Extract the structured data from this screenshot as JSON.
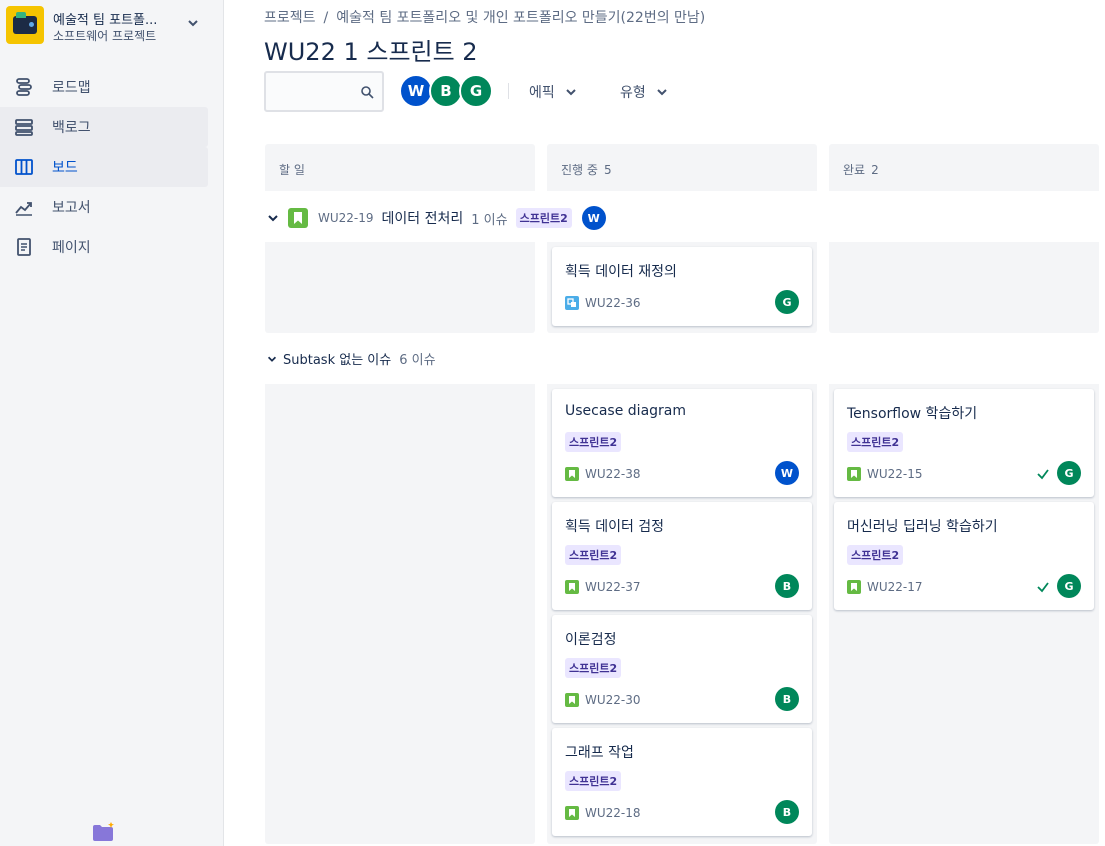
{
  "colors": {
    "accent": "#0052cc",
    "avatar_w": "#0052cc",
    "avatar_g": "#00875a",
    "avatar_b": "#00875a",
    "story": "#65ba43",
    "subtask": "#4bade8",
    "label_bg": "#eae6ff",
    "done_check": "#00875a"
  },
  "project": {
    "name": "예술적 팀 포트폴...",
    "type": "소프트웨어 프로젝트",
    "logo_icon": "project-logo-icon"
  },
  "sidebar": {
    "items": [
      {
        "label": "로드맵",
        "icon": "roadmap-icon"
      },
      {
        "label": "백로그",
        "icon": "backlog-icon"
      },
      {
        "label": "보드",
        "icon": "board-icon"
      },
      {
        "label": "보고서",
        "icon": "reports-icon"
      },
      {
        "label": "페이지",
        "icon": "pages-icon"
      }
    ]
  },
  "breadcrumb": {
    "root": "프로젝트",
    "separator": "/",
    "current": "예술적 팀 포트폴리오 및 개인 포트폴리오 만들기(22번의 만남)"
  },
  "page": {
    "title": "WU22 1 스프린트 2"
  },
  "toolbar": {
    "search_placeholder": "",
    "avatars": [
      "W",
      "B",
      "G"
    ],
    "filters": [
      "에픽",
      "유형"
    ]
  },
  "columns": [
    {
      "name": "할 일",
      "count": ""
    },
    {
      "name": "진행 중",
      "count": "5"
    },
    {
      "name": "완료",
      "count": "2"
    }
  ],
  "swimlanes": {
    "epic": {
      "key": "WU22-19",
      "title": "데이터 전처리",
      "count": "1 이슈",
      "label": "스프린트2",
      "assignee": "W"
    },
    "no_subtask": {
      "title": "Subtask 없는 이슈",
      "count": "6 이슈"
    }
  },
  "cards": {
    "c36": {
      "title": "획득 데이터 재정의",
      "key": "WU22-36",
      "assignee": "G"
    },
    "c38": {
      "title": "Usecase diagram",
      "label": "스프린트2",
      "key": "WU22-38",
      "assignee": "W"
    },
    "c37": {
      "title": "획득 데이터 검정",
      "label": "스프린트2",
      "key": "WU22-37",
      "assignee": "B"
    },
    "c30": {
      "title": "이론검정",
      "label": "스프린트2",
      "key": "WU22-30",
      "assignee": "B"
    },
    "c18": {
      "title": "그래프 작업",
      "label": "스프린트2",
      "key": "WU22-18",
      "assignee": "B"
    },
    "c15": {
      "title": "Tensorflow 학습하기",
      "label": "스프린트2",
      "key": "WU22-15",
      "assignee": "G"
    },
    "c17": {
      "title": "머신러닝 딥러닝 학습하기",
      "label": "스프린트2",
      "key": "WU22-17",
      "assignee": "G"
    }
  }
}
